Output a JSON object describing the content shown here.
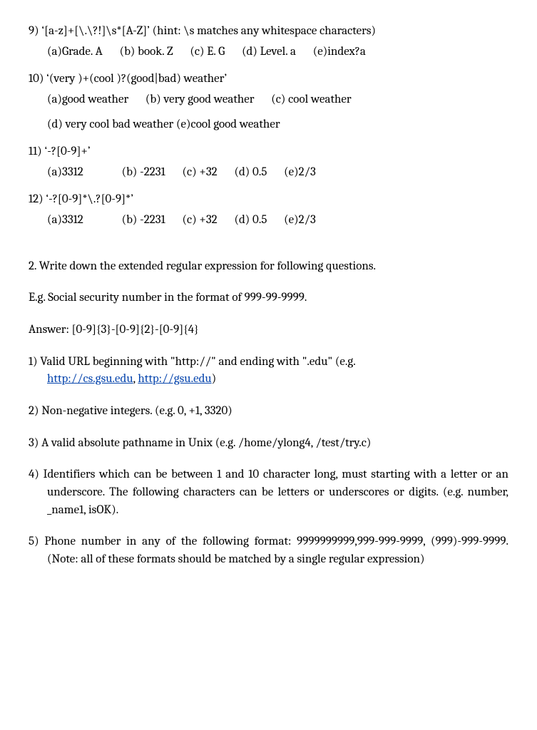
{
  "q9": {
    "prompt": "9) ‘[a-z]+[\\.\\?!]\\s*[A-Z]’ (hint: \\s matches any whitespace characters)",
    "opts": {
      "a": "(a)Grade. A",
      "b": "(b) book.  Z",
      "c": "(c) E.  G",
      "d": "(d) Level.  a",
      "e": "(e)index?a"
    }
  },
  "q10": {
    "prompt": "10)     ‘(very )+(cool )?(good|bad) weather’",
    "opts": {
      "a": "(a)good weather",
      "b": "(b) very good weather",
      "c": "(c) cool weather",
      "d": "(d) very cool bad weather",
      "e": "(e)cool good weather"
    }
  },
  "q11": {
    "prompt": "11)     ‘-?[0-9]+’",
    "opts": {
      "a": "(a)3312",
      "b": "(b) -2231",
      "c": "(c) +32",
      "d": "(d) 0.5",
      "e": "(e)2/3"
    }
  },
  "q12": {
    "prompt": "12)    ‘-?[0-9]*\\.?[0-9]*’",
    "opts": {
      "a": "(a)3312",
      "b": "(b) -2231",
      "c": "(c) +32",
      "d": "(d) 0.5",
      "e": "(e)2/3"
    }
  },
  "part2": {
    "heading": "2. Write down the extended regular expression for following questions.",
    "example": "E.g. Social security number in the format of 999-99-9999.",
    "answer": "Answer: [0-9]{3}-[0-9]{2}-[0-9]{4}",
    "q1_pre": "1) Valid URL beginning with \"http://\" and ending with \".edu\" (e.g. ",
    "q1_link1": "http://cs.gsu.edu",
    "q1_sep": ", ",
    "q1_link2": "http://gsu.edu",
    "q1_post": ")",
    "q2": "2)  Non-negative integers. (e.g. 0, +1, 3320)",
    "q3": "3)  A valid absolute pathname in Unix (e.g. /home/ylong4, /test/try.c)",
    "q4": "4) Identifiers which can be between 1 and 10 character long, must starting with a letter or an underscore. The following characters can be letters or underscores or digits. (e.g. number, _name1, isOK).",
    "q5": "5) Phone number in any of the following format: 9999999999,999-999-9999, (999)-999-9999.  (Note: all of these formats should be matched by a single regular expression)"
  }
}
